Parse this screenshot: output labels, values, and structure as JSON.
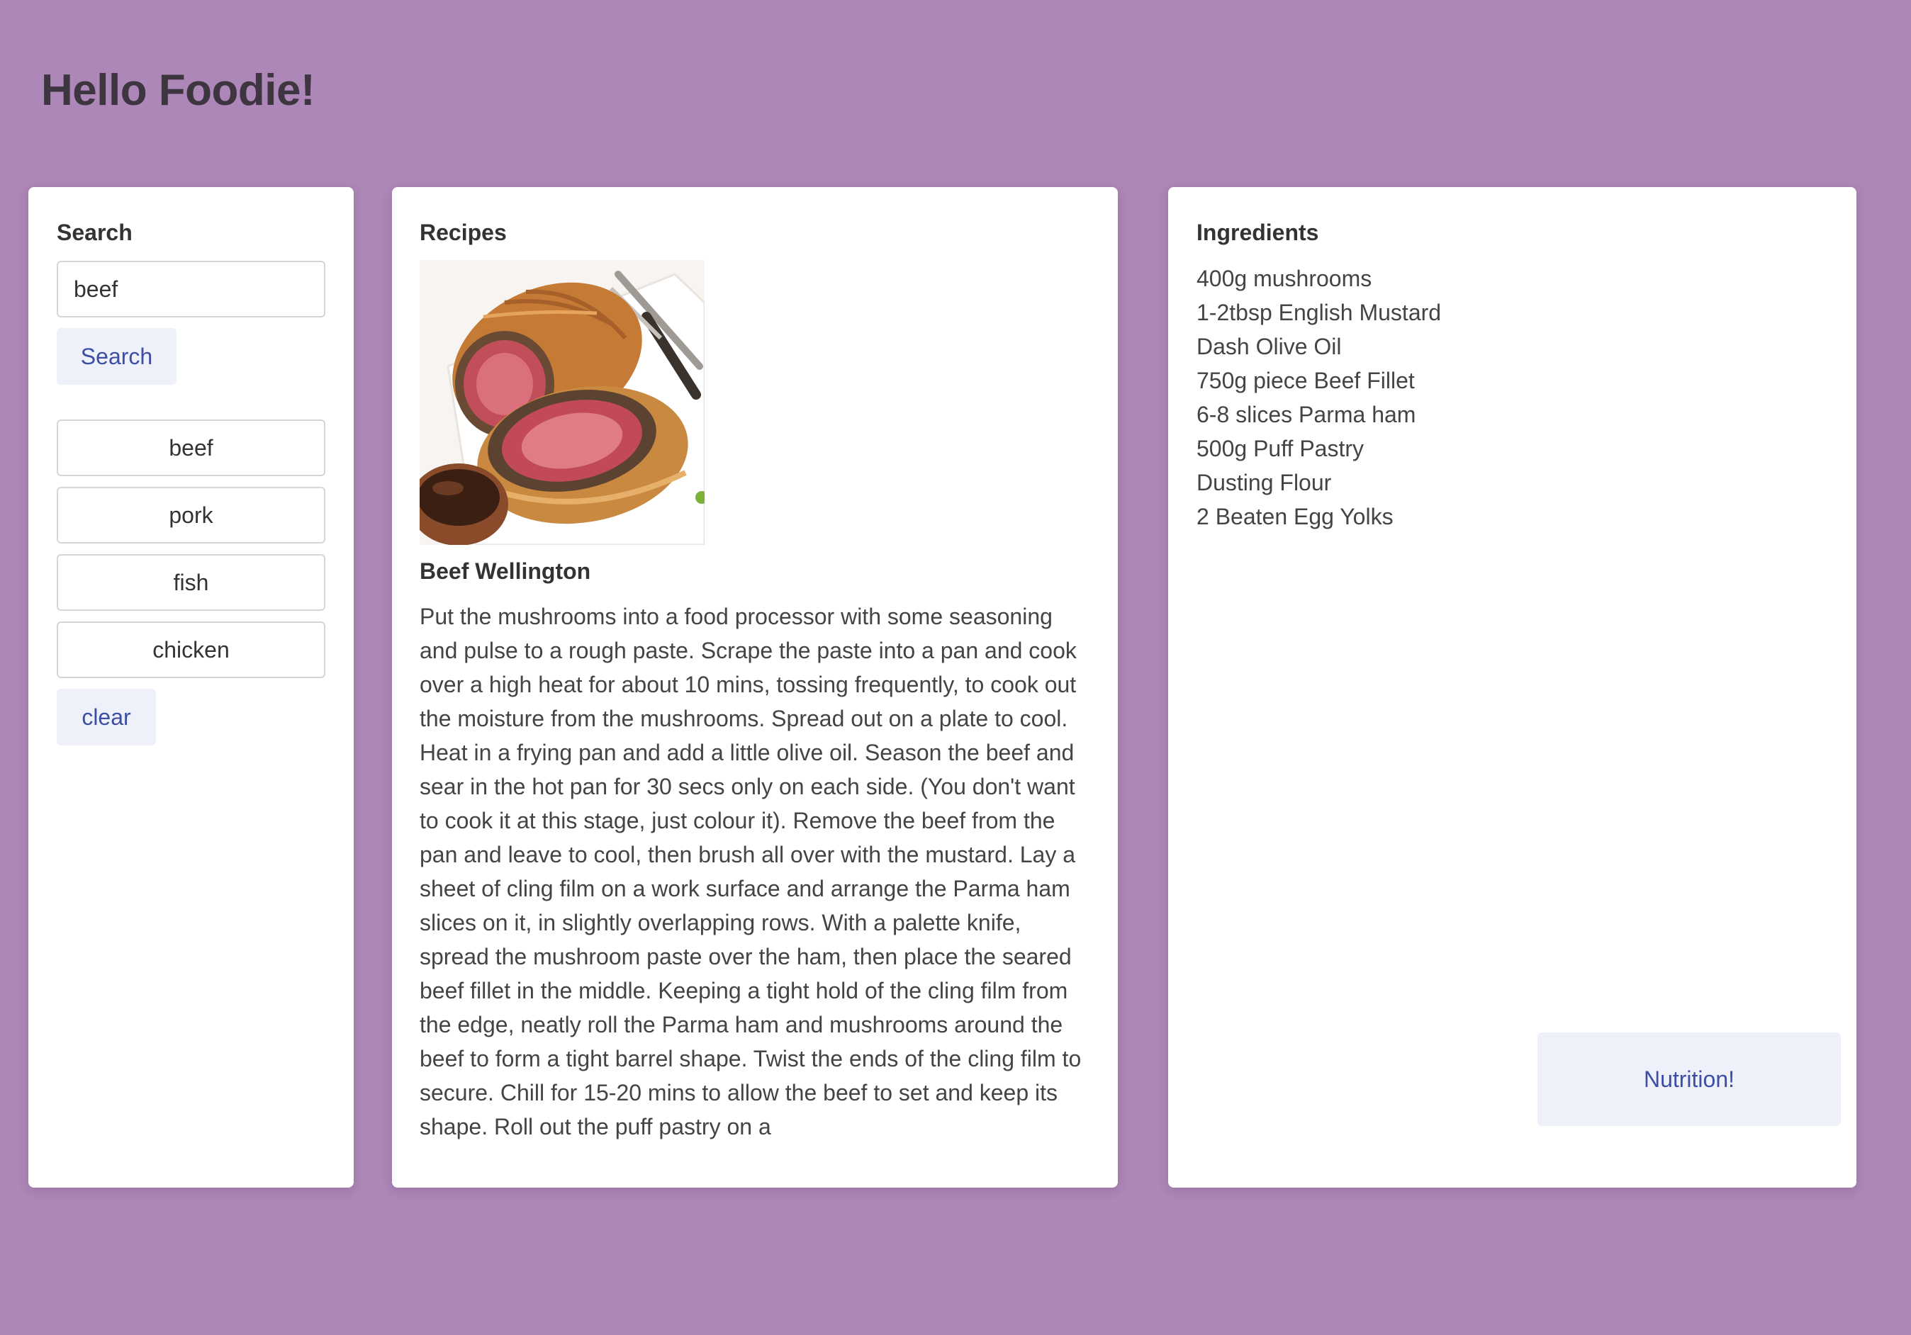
{
  "header": {
    "title": "Hello Foodie!"
  },
  "search": {
    "heading": "Search",
    "input_value": "beef",
    "search_label": "Search",
    "categories": [
      "beef",
      "pork",
      "fish",
      "chicken"
    ],
    "clear_label": "clear"
  },
  "recipes": {
    "heading": "Recipes",
    "name": "Beef Wellington",
    "instructions": "Put the mushrooms into a food processor with some seasoning and pulse to a rough paste. Scrape the paste into a pan and cook over a high heat for about 10 mins, tossing frequently, to cook out the moisture from the mushrooms. Spread out on a plate to cool. Heat in a frying pan and add a little olive oil. Season the beef and sear in the hot pan for 30 secs only on each side. (You don't want to cook it at this stage, just colour it). Remove the beef from the pan and leave to cool, then brush all over with the mustard. Lay a sheet of cling film on a work surface and arrange the Parma ham slices on it, in slightly overlapping rows. With a palette knife, spread the mushroom paste over the ham, then place the seared beef fillet in the middle. Keeping a tight hold of the cling film from the edge, neatly roll the Parma ham and mushrooms around the beef to form a tight barrel shape. Twist the ends of the cling film to secure. Chill for 15-20 mins to allow the beef to set and keep its shape. Roll out the puff pastry on a"
  },
  "ingredients": {
    "heading": "Ingredients",
    "items": [
      "400g mushrooms",
      "1-2tbsp English Mustard",
      "Dash Olive Oil",
      "750g piece Beef Fillet",
      "6-8 slices Parma ham",
      "500g Puff Pastry",
      "Dusting Flour",
      "2 Beaten Egg Yolks"
    ],
    "nutrition_label": "Nutrition!"
  },
  "colors": {
    "background": "#ad87b7",
    "card": "#ffffff",
    "button_bg": "#eef0fa",
    "button_text": "#3d4ea5"
  }
}
